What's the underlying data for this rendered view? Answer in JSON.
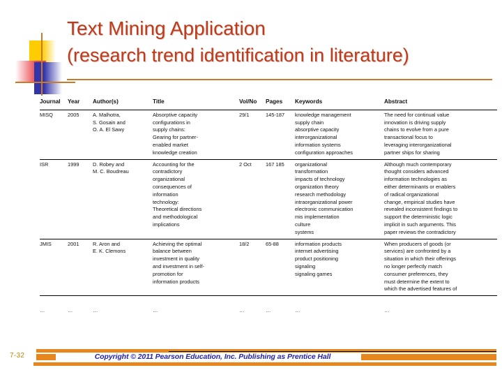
{
  "slide": {
    "title_line1": "Text Mining Application",
    "title_line2": "(research trend identification in literature)",
    "title_color": "#BE3A1A",
    "accent_color": "#C87A2A",
    "slide_number": "7-32"
  },
  "footer": {
    "copyright": "Copyright © 2011 Pearson Education, Inc. Publishing as Prentice Hall",
    "bar_color": "#E8861E",
    "text_color": "#2222AA"
  },
  "table": {
    "columns": [
      "Journal",
      "Year",
      "Author(s)",
      "Title",
      "Vol/No",
      "Pages",
      "Keywords",
      "Abstract"
    ],
    "rows": [
      {
        "journal": "MISQ",
        "year": "2005",
        "authors": [
          "A. Malhotra,",
          "S. Gosain and",
          "O. A. El Sawy"
        ],
        "title": [
          "Absorptive capacity",
          "configurations in",
          "supply chains:",
          "Gearing for partner-",
          "enabled market",
          "knowledge creation"
        ],
        "volno": "29/1",
        "pages": "145-187",
        "keywords": [
          "knowledge management",
          "supply chain",
          "absorptive capacity",
          "interorganizational",
          "information systems",
          "configuration approaches"
        ],
        "abstract": [
          "The need for continual value",
          "innovation is driving supply",
          "chains to evolve from a pure",
          "transactional focus to",
          "leveraging interorganizational",
          "partner ships for sharing"
        ]
      },
      {
        "journal": "ISR",
        "year": "1999",
        "authors": [
          "D. Robey and",
          "M. C. Boudreau"
        ],
        "title": [
          "Accounting for the",
          "contradictory",
          "organizational",
          "consequences of",
          "information",
          "technology:",
          "Theoretical directions",
          "and methodological",
          "implications"
        ],
        "volno": "2 Oct",
        "pages": "167 185",
        "keywords": [
          "organizational",
          "transformation",
          "impacts of technology",
          "organization theory",
          "research methodology",
          "intraorganizational power",
          "electronic communication",
          "mis implementation",
          "culture",
          "systems"
        ],
        "abstract": [
          "Although much contemporary",
          "thought considers advanced",
          "information technologies as",
          "either determinants or enablers",
          "of radical organizational",
          "change, empirical studies have",
          "revealed inconsistent findings to",
          "support the deterministic logic",
          "implicit in such arguments. This",
          "paper reviews the contradictory"
        ]
      },
      {
        "journal": "JMIS",
        "year": "2001",
        "authors": [
          "R. Aron and",
          "E. K. Clemons"
        ],
        "title": [
          "Achieving the optimal",
          "balance between",
          "investment in quality",
          "and investment in self-",
          "promotion for",
          "information products"
        ],
        "volno": "18/2",
        "pages": "65-88",
        "keywords": [
          "information products",
          "internet advertising",
          "product positioning",
          "signaling",
          "signaling games"
        ],
        "abstract": [
          "When producers of goods (or",
          "services) are confronted by a",
          "situation in which their offerings",
          "no longer perfectly match",
          "consumer preferences, they",
          "must determine the extent to",
          "which the advertised features of"
        ]
      }
    ],
    "ellipsis_row": [
      "…",
      "…",
      "…",
      "…",
      "…",
      "…",
      "…",
      "…"
    ]
  }
}
